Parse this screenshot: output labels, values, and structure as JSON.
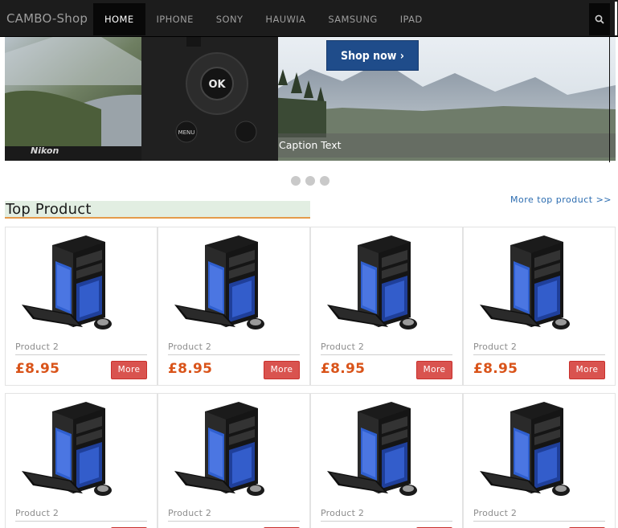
{
  "navbar": {
    "brand": "CAMBO-Shop",
    "items": [
      {
        "label": "HOME",
        "active": true
      },
      {
        "label": "IPHONE",
        "active": false
      },
      {
        "label": "SONY",
        "active": false
      },
      {
        "label": "HAUWIA",
        "active": false
      },
      {
        "label": "SAMSUNG",
        "active": false
      },
      {
        "label": "IPAD",
        "active": false
      }
    ],
    "search_icon": "search-icon"
  },
  "carousel": {
    "cta_label": "Shop now ›",
    "caption": "Caption Text",
    "camera_brand": "Nikon",
    "camera_buttons": {
      "ok": "OK",
      "menu": "MENU"
    },
    "indicator_count": 3
  },
  "top_products": {
    "title": "Top Product",
    "more_link": "More top product >>",
    "products": [
      {
        "name": "Product 2",
        "price": "£8.95",
        "button": "More"
      },
      {
        "name": "Product 2",
        "price": "£8.95",
        "button": "More"
      },
      {
        "name": "Product 2",
        "price": "£8.95",
        "button": "More"
      },
      {
        "name": "Product 2",
        "price": "£8.95",
        "button": "More"
      },
      {
        "name": "Product 2",
        "price": "",
        "button": ""
      },
      {
        "name": "Product 2",
        "price": "",
        "button": ""
      },
      {
        "name": "Product 2",
        "price": "",
        "button": ""
      },
      {
        "name": "Product 2",
        "price": "",
        "button": ""
      }
    ]
  },
  "colors": {
    "navbar_bg": "#1c1c1c",
    "cta_bg": "#1f4c8a",
    "price": "#d9541a",
    "more_button": "#d9534f",
    "section_bg": "#e2eee2",
    "section_underline": "#e49a4b",
    "link": "#2b6cb0"
  }
}
